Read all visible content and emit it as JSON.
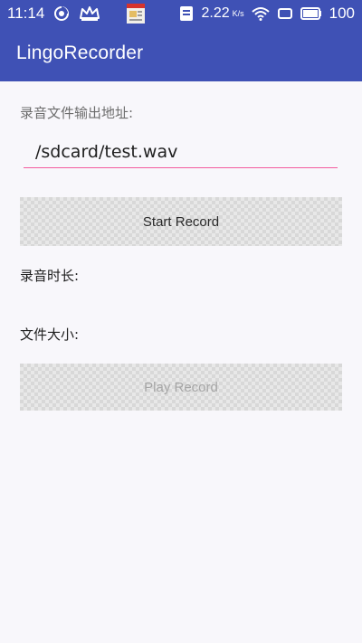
{
  "status_bar": {
    "time": "11:14",
    "speed": "2.22",
    "speed_unit": "K/s",
    "battery": "100"
  },
  "app_bar": {
    "title": "LingoRecorder"
  },
  "main": {
    "output_label": "录音文件输出地址:",
    "path_value": "/sdcard/test.wav",
    "start_button": "Start Record",
    "duration_label": "录音时长:",
    "size_label": "文件大小:",
    "play_button": "Play Record"
  },
  "colors": {
    "primary": "#3f51b5",
    "input_underline": "#f45b9f",
    "background": "#f8f7fb"
  }
}
